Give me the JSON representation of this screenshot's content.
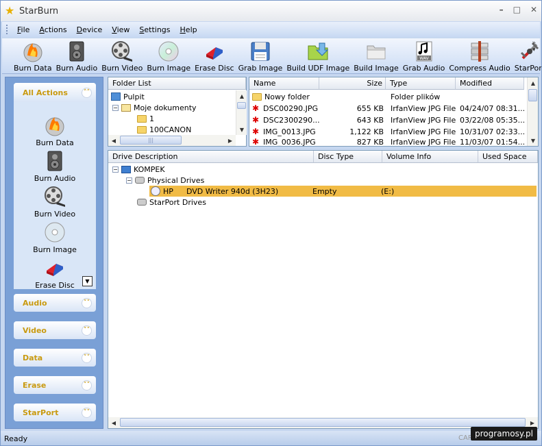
{
  "window": {
    "title": "StarBurn",
    "minimize": "–",
    "restore": "□",
    "close": "✕"
  },
  "menu": {
    "items": [
      {
        "first": "F",
        "rest": "ile"
      },
      {
        "first": "A",
        "rest": "ctions"
      },
      {
        "first": "D",
        "rest": "evice"
      },
      {
        "first": "V",
        "rest": "iew"
      },
      {
        "first": "S",
        "rest": "ettings"
      },
      {
        "first": "H",
        "rest": "elp"
      }
    ]
  },
  "toolbar": {
    "buttons": [
      {
        "label": "Burn Data",
        "icon": "burn-data-icon"
      },
      {
        "label": "Burn Audio",
        "icon": "speaker-icon"
      },
      {
        "label": "Burn Video",
        "icon": "film-reel-icon"
      },
      {
        "label": "Burn Image",
        "icon": "disc-icon"
      },
      {
        "label": "Erase Disc",
        "icon": "eraser-icon"
      },
      {
        "label": "Grab Image",
        "icon": "floppy-icon"
      },
      {
        "label": "Build UDF Image",
        "icon": "udf-folder-icon"
      },
      {
        "label": "Build Image",
        "icon": "folder-icon"
      },
      {
        "label": "Grab Audio",
        "icon": "wav-icon"
      },
      {
        "label": "Compress Audio",
        "icon": "compress-icon"
      },
      {
        "label": "StarPort",
        "icon": "starport-icon"
      }
    ],
    "more": "»"
  },
  "sidebar": {
    "all_actions": {
      "title": "All Actions",
      "items": [
        {
          "label": "Burn Data"
        },
        {
          "label": "Burn Audio"
        },
        {
          "label": "Burn Video"
        },
        {
          "label": "Burn Image"
        },
        {
          "label": "Erase Disc"
        }
      ]
    },
    "sections": [
      {
        "title": "Audio"
      },
      {
        "title": "Video"
      },
      {
        "title": "Data"
      },
      {
        "title": "Erase"
      },
      {
        "title": "StarPort"
      }
    ],
    "chevron_up": "˄˄",
    "chevron_down": "˅˅"
  },
  "folder_list": {
    "header": "Folder List",
    "items": [
      {
        "label": "Pulpit",
        "type": "desktop"
      },
      {
        "label": "Moje dokumenty",
        "type": "docs",
        "expander": "−"
      },
      {
        "label": "1",
        "type": "folder"
      },
      {
        "label": "100CANON",
        "type": "folder"
      }
    ],
    "hscroll_grip": "|||"
  },
  "file_list": {
    "columns": [
      "Name",
      "Size",
      "Type",
      "Modified"
    ],
    "rows": [
      {
        "name": "Nowy folder",
        "size": "",
        "type": "Folder plików",
        "modified": "",
        "kind": "folder"
      },
      {
        "name": "DSC00290.JPG",
        "size": "655 KB",
        "type": "IrfanView JPG File",
        "modified": "04/24/07 08:31...",
        "kind": "jpg"
      },
      {
        "name": "DSC2300290...",
        "size": "643 KB",
        "type": "IrfanView JPG File",
        "modified": "03/22/08 05:35...",
        "kind": "jpg"
      },
      {
        "name": "IMG_0013.JPG",
        "size": "1,122 KB",
        "type": "IrfanView JPG File",
        "modified": "10/31/07 02:33...",
        "kind": "jpg"
      },
      {
        "name": "IMG_0036.JPG",
        "size": "827 KB",
        "type": "IrfanView JPG File",
        "modified": "11/03/07 01:54...",
        "kind": "jpg"
      }
    ]
  },
  "drive_list": {
    "columns": [
      "Drive Description",
      "Disc Type",
      "Volume Info",
      "Used Space"
    ],
    "computer": "KOMPEK",
    "physical": "Physical Drives",
    "drive": {
      "vendor": "HP",
      "model": "DVD Writer 940d  (3H23)",
      "disc_type": "Empty",
      "volume": "(E:)"
    },
    "starport": "StarPort Drives",
    "expander": "−"
  },
  "status": {
    "text": "Ready",
    "cap": "CAP",
    "num": "NUM"
  },
  "watermark": "programosy.pl",
  "colors": {
    "accent": "#c99a10",
    "selection": "#f1bb45",
    "sidebar_bg": "#7aa0d6"
  }
}
